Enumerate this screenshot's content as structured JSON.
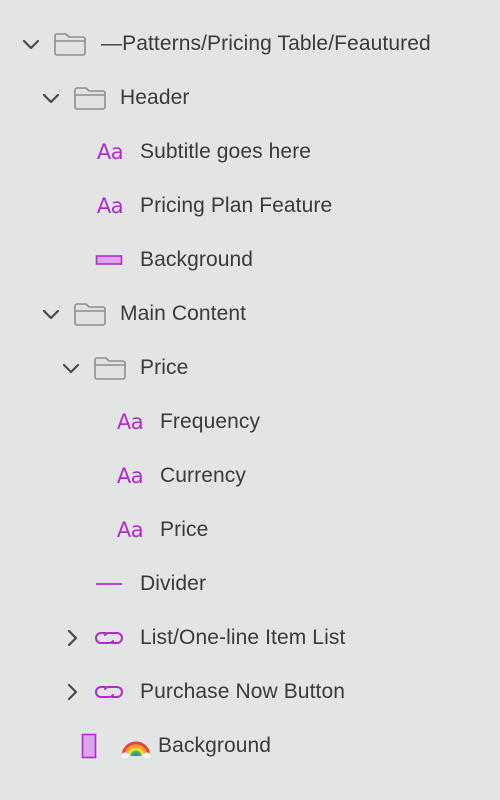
{
  "layers": {
    "root": {
      "label": "—Patterns/Pricing Table/Feautured",
      "icon": "folder-icon",
      "expanded": true
    },
    "header": {
      "label": "Header",
      "icon": "folder-icon",
      "expanded": true
    },
    "subtitle": {
      "label": "Subtitle goes here",
      "icon": "text-layer-icon",
      "icon_text": "Aa"
    },
    "pricing_plan_feature": {
      "label": "Pricing Plan Feature",
      "icon": "text-layer-icon",
      "icon_text": "Aa"
    },
    "header_background": {
      "label": "Background",
      "icon": "rectangle-layer-icon"
    },
    "main_content": {
      "label": "Main Content",
      "icon": "folder-icon",
      "expanded": true
    },
    "price_group": {
      "label": "Price",
      "icon": "folder-icon",
      "expanded": true
    },
    "frequency": {
      "label": "Frequency",
      "icon": "text-layer-icon",
      "icon_text": "Aa"
    },
    "currency": {
      "label": "Currency",
      "icon": "text-layer-icon",
      "icon_text": "Aa"
    },
    "price_text": {
      "label": "Price",
      "icon": "text-layer-icon",
      "icon_text": "Aa"
    },
    "divider": {
      "label": "Divider",
      "icon": "line-layer-icon"
    },
    "item_list": {
      "label": "List/One-line Item List",
      "icon": "symbol-instance-icon",
      "expanded": false
    },
    "purchase_button": {
      "label": "Purchase Now Button",
      "icon": "symbol-instance-icon",
      "expanded": false
    },
    "main_background": {
      "label": "Background",
      "icon": "rectangle-layer-icon",
      "emoji": "🌈"
    }
  },
  "colors": {
    "background": "#e3e4e4",
    "text": "#3a3a3a",
    "chevron": "#4a4a4a",
    "folder": "#8e8e8e",
    "accent": "#b02ad0"
  }
}
